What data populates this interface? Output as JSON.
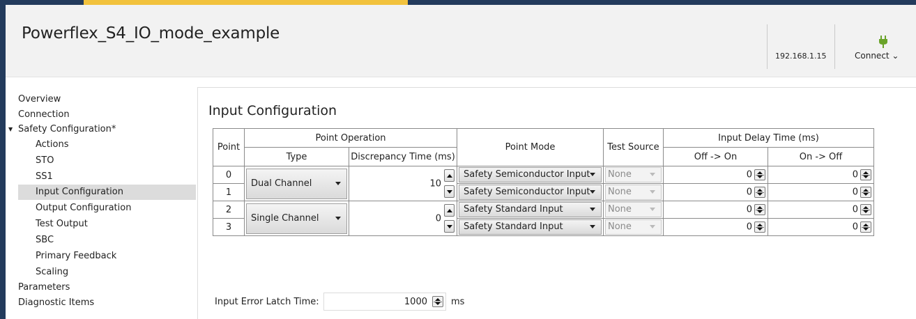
{
  "window": {
    "title": "Powerflex_S4_IO_mode_example",
    "ip_address": "192.168.1.15",
    "connect_label": "Connect ⌄"
  },
  "sidebar": {
    "items": [
      {
        "label": "Overview"
      },
      {
        "label": "Connection"
      },
      {
        "label": "Safety Configuration*"
      },
      {
        "label": "Actions"
      },
      {
        "label": "STO"
      },
      {
        "label": "SS1"
      },
      {
        "label": "Input Configuration"
      },
      {
        "label": "Output Configuration"
      },
      {
        "label": "Test Output"
      },
      {
        "label": "SBC"
      },
      {
        "label": "Primary Feedback"
      },
      {
        "label": "Scaling"
      },
      {
        "label": "Parameters"
      },
      {
        "label": "Diagnostic Items"
      }
    ],
    "expander_glyph": "▼",
    "selected": "Input Configuration"
  },
  "main": {
    "section_title": "Input Configuration",
    "table": {
      "headers": {
        "point": "Point",
        "point_operation": "Point Operation",
        "type": "Type",
        "discrepancy_time": "Discrepancy Time (ms)",
        "point_mode": "Point Mode",
        "test_source": "Test Source",
        "input_delay_time": "Input Delay Time (ms)",
        "off_on": "Off -> On",
        "on_off": "On -> Off"
      },
      "pairs": [
        {
          "type": "Dual Channel",
          "discrepancy_time": "10"
        },
        {
          "type": "Single Channel",
          "discrepancy_time": "0"
        }
      ],
      "rows": [
        {
          "point": "0",
          "point_mode": "Safety Semiconductor Input",
          "test_source": "None",
          "off_on": "0",
          "on_off": "0"
        },
        {
          "point": "1",
          "point_mode": "Safety Semiconductor Input",
          "test_source": "None",
          "off_on": "0",
          "on_off": "0"
        },
        {
          "point": "2",
          "point_mode": "Safety Standard Input",
          "test_source": "None",
          "off_on": "0",
          "on_off": "0"
        },
        {
          "point": "3",
          "point_mode": "Safety Standard Input",
          "test_source": "None",
          "off_on": "0",
          "on_off": "0"
        }
      ]
    },
    "input_error_latch": {
      "label": "Input Error Latch Time:",
      "value": "1000",
      "unit": "ms"
    }
  },
  "colors": {
    "frame": "#233b5c",
    "frame_accent": "#f2c23d",
    "selected_nav": "#dcdcdc",
    "connect_icon": "#6aa329"
  }
}
